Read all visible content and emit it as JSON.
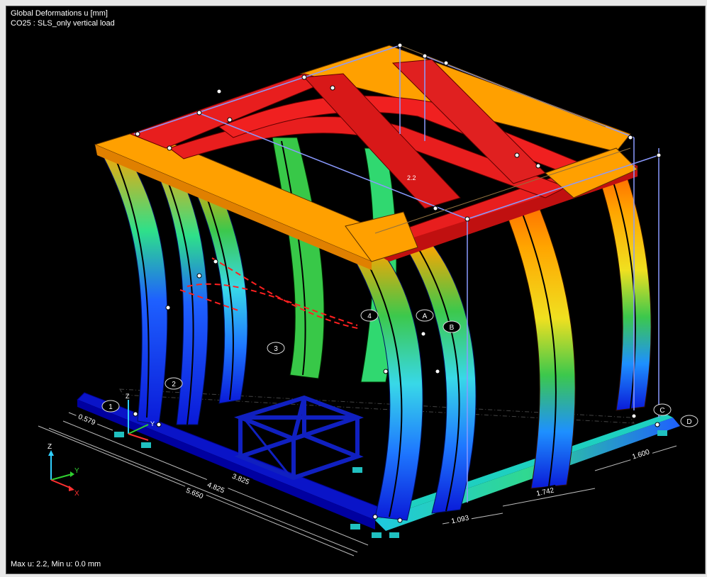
{
  "title_line1": "Global Deformations u [mm]",
  "title_line2": "CO25 : SLS_only vertical load",
  "footer": "Max u: 2.2, Min u: 0.0 mm",
  "peak_label": "2.2",
  "axis_labels": {
    "x": "X",
    "y": "Y",
    "z": "Z"
  },
  "grid_labels": {
    "g1": "1",
    "g2": "2",
    "g3": "3",
    "g4": "4",
    "gA": "A",
    "gB": "B",
    "gC": "C",
    "gD": "D"
  },
  "dimensions": {
    "d1": "0.579",
    "d2": "3.825",
    "d3": "4.825",
    "d4": "5.650",
    "d5": "1.093",
    "d6": "1.742",
    "d7": "1.600"
  },
  "colors": {
    "background": "#000000",
    "deform_scale": [
      "#0000c8",
      "#0a40ff",
      "#1e90ff",
      "#3ad8e8",
      "#2ee08a",
      "#3cc83c",
      "#a0e020",
      "#f0e020",
      "#ffa500",
      "#ff6000",
      "#e81e1e"
    ]
  }
}
